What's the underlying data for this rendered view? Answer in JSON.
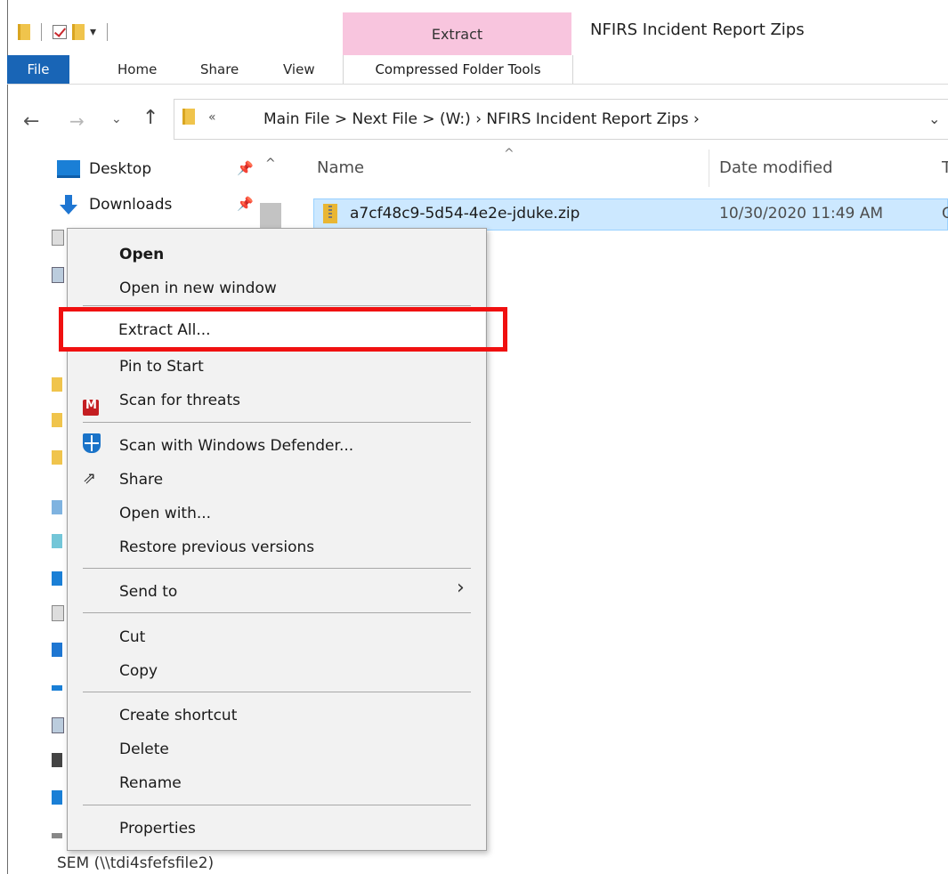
{
  "window": {
    "title": "NFIRS Incident Report Zips"
  },
  "ribbon": {
    "qat_dropdown": "▾",
    "contextual_tab_header": "Extract",
    "tabs": {
      "file": "File",
      "home": "Home",
      "share": "Share",
      "view": "View",
      "compressed": "Compressed Folder Tools"
    }
  },
  "address": {
    "back": "←",
    "forward": "→",
    "recent": "⌄",
    "up": "↑",
    "overflow": "«",
    "path": "Main File >  Next File >        (W:)  ›  NFIRS Incident Report Zips  ›",
    "dropdown": "⌄"
  },
  "nav_pane": {
    "items": [
      {
        "label": "Desktop",
        "icon": "desktop-icon",
        "pin": "📌"
      },
      {
        "label": "Downloads",
        "icon": "downloads-icon",
        "pin": "📌"
      }
    ],
    "scroll_up": "^",
    "bottom_item": "SEM (\\\\tdi4sfefsfile2)"
  },
  "file_list": {
    "sort_indicator": "^",
    "columns": {
      "name": "Name",
      "date_modified": "Date modified",
      "type": "T"
    },
    "rows": [
      {
        "name": "a7cf48c9-5d54-4e2e-jduke.zip",
        "date": "10/30/2020 11:49 AM",
        "type": "C"
      }
    ]
  },
  "context_menu": {
    "items": {
      "open": "Open",
      "open_new_window": "Open in new window",
      "extract_all": "Extract All...",
      "pin_to_start": "Pin to Start",
      "scan_threats": "Scan for threats",
      "scan_defender": "Scan with Windows Defender...",
      "share": "Share",
      "open_with": "Open with...",
      "restore_versions": "Restore previous versions",
      "send_to": "Send to",
      "cut": "Cut",
      "copy": "Copy",
      "create_shortcut": "Create shortcut",
      "delete": "Delete",
      "rename": "Rename",
      "properties": "Properties"
    },
    "submenu_arrow": "›",
    "share_glyph": "⇗",
    "highlight_color": "#f01010"
  },
  "colors": {
    "file_tab": "#1965b6",
    "extract_header": "#f8c5de",
    "selection": "#cce8ff"
  }
}
